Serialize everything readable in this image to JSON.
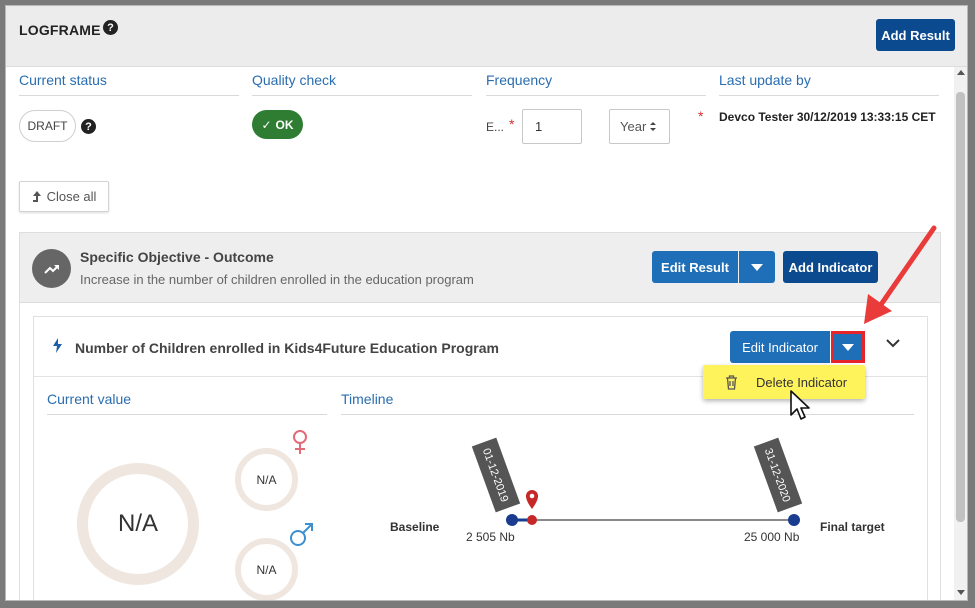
{
  "header": {
    "title": "LOGFRAME",
    "add_result_label": "Add Result"
  },
  "meta": {
    "current_status_label": "Current status",
    "quality_check_label": "Quality check",
    "frequency_label": "Frequency",
    "last_update_label": "Last update by",
    "status_value": "DRAFT",
    "quality_value": "OK",
    "frequency_short_label": "E...",
    "frequency_value": "1",
    "frequency_unit": "Year",
    "last_update_value": "Devco Tester 30/12/2019 13:33:15 CET"
  },
  "toolbar": {
    "close_all_label": "Close all"
  },
  "result": {
    "title": "Specific Objective - Outcome",
    "subtitle": "Increase in the number of children enrolled in the education program",
    "edit_label": "Edit Result",
    "add_indicator_label": "Add Indicator"
  },
  "indicator": {
    "title": "Number of Children enrolled in Kids4Future Education Program",
    "edit_label": "Edit Indicator",
    "delete_label": "Delete Indicator",
    "current_value_label": "Current value",
    "timeline_label": "Timeline",
    "current_value": "N/A",
    "female_value": "N/A",
    "male_value": "N/A"
  },
  "timeline": {
    "baseline_label": "Baseline",
    "final_label": "Final target",
    "start_date": "01-12-2019",
    "end_date": "31-12-2020",
    "baseline_value": "2 505 Nb",
    "final_value": "25 000 Nb"
  },
  "colors": {
    "primary": "#1f6fb8",
    "dark_primary": "#0b4a8f",
    "ok_green": "#2e7d32",
    "highlight_red": "#e8242b",
    "menu_yellow": "#fff35c"
  }
}
